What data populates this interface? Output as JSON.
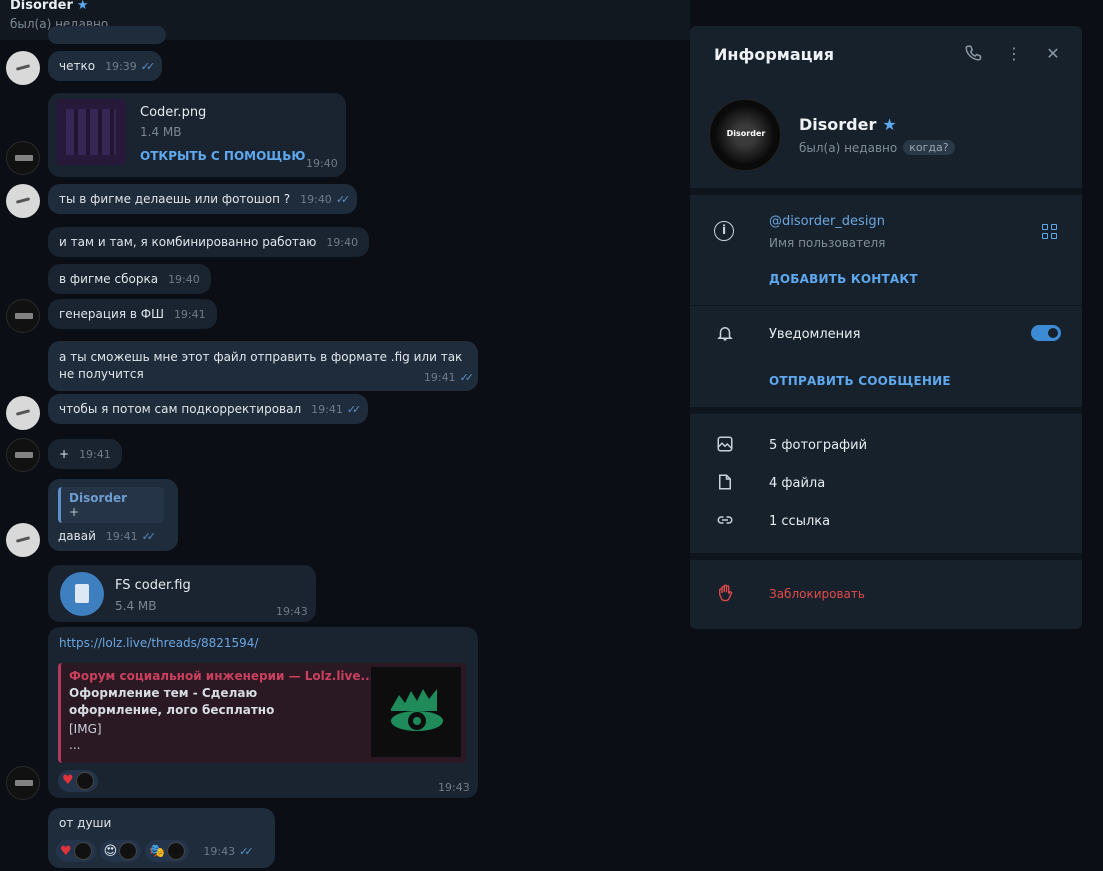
{
  "header": {
    "name": "Disorder",
    "status": "был(а) недавно"
  },
  "messages": [
    {
      "text": "четко",
      "time": "19:39",
      "checks": "✓✓"
    },
    {
      "file_name": "Coder.png",
      "file_size": "1.4 MB",
      "action": "ОТКРЫТЬ С ПОМОЩЬЮ",
      "time": "19:40"
    },
    {
      "text": "ты в фигме делаешь или фотошоп ?",
      "time": "19:40",
      "checks": "✓✓"
    },
    {
      "text": "и там и там, я комбинированно работаю",
      "time": "19:40"
    },
    {
      "text": "в фигме сборка",
      "time": "19:40"
    },
    {
      "text": "генерация в ФШ",
      "time": "19:41"
    },
    {
      "text": "а ты сможешь мне этот файл отправить в формате .fig или так не получится",
      "time": "19:41",
      "checks": "✓✓"
    },
    {
      "text": "чтобы я потом сам подкорректировал",
      "time": "19:41",
      "checks": "✓✓"
    },
    {
      "text": "+",
      "time": "19:41"
    },
    {
      "reply_name": "Disorder",
      "reply_text": "+",
      "text": "давай",
      "time": "19:41",
      "checks": "✓✓"
    },
    {
      "file_name": "FS coder.fig",
      "file_size": "5.4 MB",
      "time": "19:43"
    },
    {
      "link": "https://lolz.live/threads/8821594/",
      "preview_site": "Форум социальной инженерии — Lolz.live...",
      "preview_title": "Оформление тем - Сделаю оформление, лого бесплатно",
      "preview_body_1": "[IMG]",
      "preview_body_2": "...",
      "reaction": "♥",
      "time": "19:43"
    },
    {
      "text": "от души",
      "reactions": [
        "♥",
        "😍",
        "🎭"
      ],
      "time": "19:43",
      "checks": "✓✓"
    }
  ],
  "panel": {
    "title": "Информация",
    "name": "Disorder",
    "status": "был(а) недавно",
    "when_badge": "когда?",
    "avatar_text": "Disorder",
    "username": "@disorder_design",
    "username_label": "Имя пользователя",
    "add_contact": "ДОБАВИТЬ КОНТАКТ",
    "notifications": "Уведомления",
    "send_message": "ОТПРАВИТЬ СООБЩЕНИЕ",
    "photos": "5 фотографий",
    "files": "4 файла",
    "links": "1 ссылка",
    "block": "Заблокировать"
  },
  "colors": {
    "accent": "#5fa8ee",
    "danger": "#e24a4a",
    "panel_bg": "#17212b"
  }
}
